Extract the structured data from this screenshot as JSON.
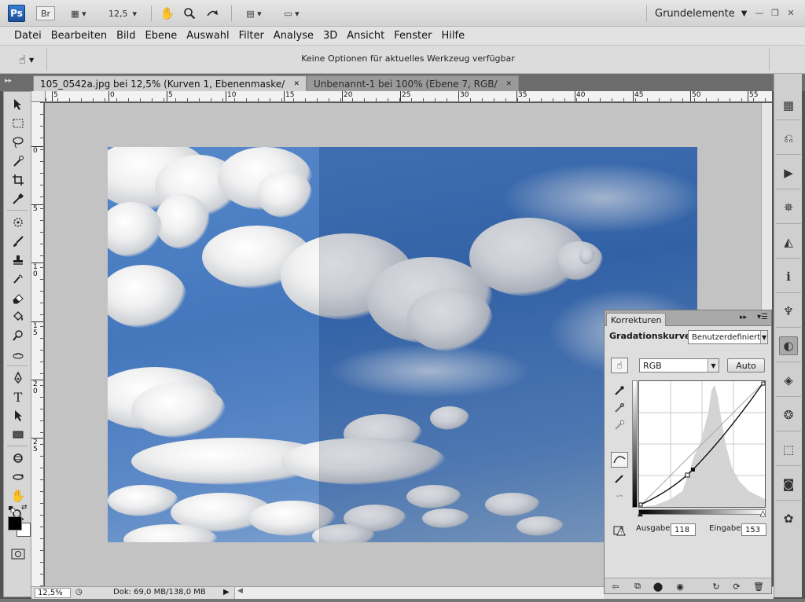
{
  "app": {
    "logo": "Ps",
    "bridge_label": "Br",
    "zoom_value": "12,5",
    "workspace": "Grundelemente"
  },
  "menu": [
    "Datei",
    "Bearbeiten",
    "Bild",
    "Ebene",
    "Auswahl",
    "Filter",
    "Analyse",
    "3D",
    "Ansicht",
    "Fenster",
    "Hilfe"
  ],
  "options": {
    "message": "Keine Optionen für aktuelles Werkzeug verfügbar"
  },
  "tabs": [
    {
      "label": "105_0542a.jpg bei 12,5% (Kurven 1, Ebenenmaske/8) *",
      "active": true
    },
    {
      "label": "Unbenannt-1 bei 100% (Ebene 7, RGB/8) *",
      "active": false
    }
  ],
  "ruler": {
    "h_labels": [
      "5",
      "0",
      "5",
      "10",
      "15",
      "20",
      "25",
      "30",
      "35",
      "40",
      "45",
      "50",
      "55"
    ],
    "v_labels": [
      "0",
      "5",
      "1\n0",
      "1\n5",
      "2\n0",
      "2\n5"
    ]
  },
  "status": {
    "zoom": "12,5%",
    "doc": "Dok: 69,0 MB/138,0 MB"
  },
  "korrekturen": {
    "tab_label": "Korrekturen",
    "title": "Gradationskurven",
    "preset": "Benutzerdefiniert",
    "channel": "RGB",
    "auto_label": "Auto",
    "output_label": "Ausgabe:",
    "output_value": "118",
    "input_label": "Eingabe:",
    "input_value": "153"
  },
  "colors": {
    "accent": "#1b4f9a",
    "selected_tool_bg": "#b9c7d8"
  }
}
